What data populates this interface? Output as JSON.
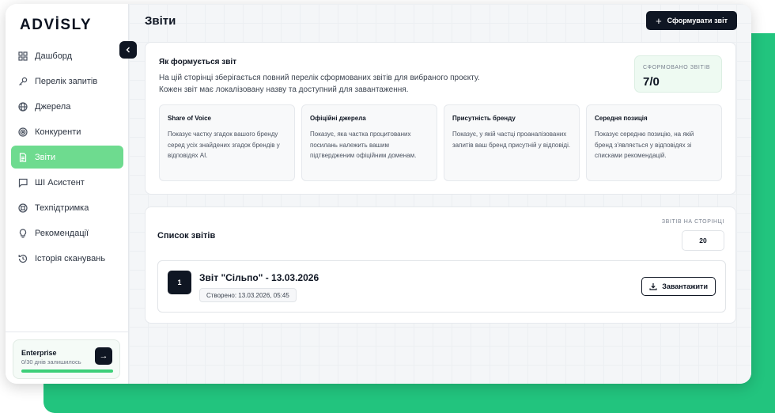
{
  "app": {
    "logo": "ADVİSLY"
  },
  "sidebar": {
    "items": [
      {
        "label": "Дашборд",
        "icon": "grid-icon",
        "active": false
      },
      {
        "label": "Перелік запитів",
        "icon": "key-icon",
        "active": false
      },
      {
        "label": "Джерела",
        "icon": "globe-icon",
        "active": false
      },
      {
        "label": "Конкуренти",
        "icon": "target-icon",
        "active": false
      },
      {
        "label": "Звіти",
        "icon": "document-icon",
        "active": true
      },
      {
        "label": "ШІ Асистент",
        "icon": "chat-icon",
        "active": false
      },
      {
        "label": "Техпідтримка",
        "icon": "lifebuoy-icon",
        "active": false
      },
      {
        "label": "Рекомендації",
        "icon": "lightbulb-icon",
        "active": false
      },
      {
        "label": "Історія сканувань",
        "icon": "history-icon",
        "active": false
      }
    ],
    "plan": {
      "name": "Enterprise",
      "remaining": "0/30 днів залишилось",
      "progress": 1.0
    }
  },
  "header": {
    "title": "Звіти",
    "generate_label": "Сформувати звіт"
  },
  "info": {
    "title": "Як формується звіт",
    "description_line1": "На цій сторінці зберігається повний перелік сформованих звітів для вибраного проєкту.",
    "description_line2": "Кожен звіт має локалізовану назву та доступний для завантаження.",
    "stat_label": "СФОРМОВАНО ЗВІТІВ",
    "stat_value": "7/0",
    "metrics": [
      {
        "title": "Share of Voice",
        "desc": "Показує частку згадок вашого бренду серед усіх знайдених згадок брендів у відповідях AI."
      },
      {
        "title": "Офіційні джерела",
        "desc": "Показує, яка частка процитованих посилань належить вашим підтвердженим офіційним доменам."
      },
      {
        "title": "Присутність бренду",
        "desc": "Показує, у якій частці проаналізованих запитів ваш бренд присутній у відповіді."
      },
      {
        "title": "Середня позиція",
        "desc": "Показує середню позицію, на якій бренд з'являється у відповідях зі списками рекомендацій."
      }
    ]
  },
  "reports": {
    "title": "Список звітів",
    "per_page_label": "ЗВІТІВ НА СТОРІНЦІ",
    "per_page_value": "20",
    "items": [
      {
        "number": "1",
        "title": "Звіт \"Сільпо\" - 13.03.2026",
        "created": "Створено: 13.03.2026, 05:45",
        "download_label": "Завантажити"
      }
    ]
  },
  "colors": {
    "accent": "#6edb8f",
    "brand_green": "#22c47e",
    "dark": "#0f1623"
  }
}
